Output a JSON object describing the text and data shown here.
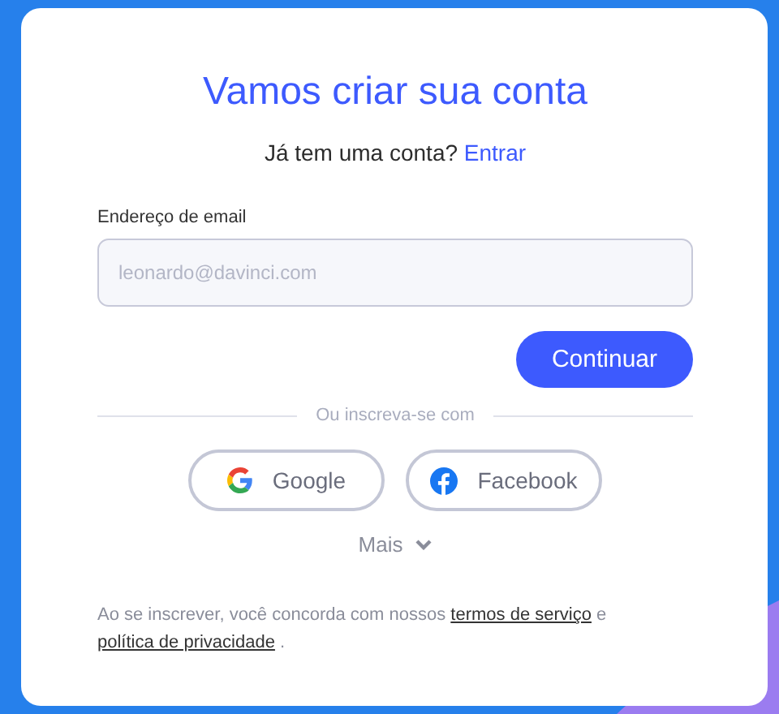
{
  "title": "Vamos criar sua conta",
  "signin": {
    "prompt": "Já tem uma conta?",
    "link": "Entrar"
  },
  "email": {
    "label": "Endereço de email",
    "placeholder": "leonardo@davinci.com"
  },
  "continue_button": "Continuar",
  "divider": "Ou inscreva-se com",
  "social": [
    {
      "kind": "google",
      "label": "Google"
    },
    {
      "kind": "facebook",
      "label": "Facebook"
    }
  ],
  "more": "Mais",
  "legal": {
    "before": "Ao se inscrever, você concorda com nossos",
    "terms_link": "termos de serviço",
    "middle": "e",
    "privacy_link": "política de privacidade",
    "end": "."
  }
}
